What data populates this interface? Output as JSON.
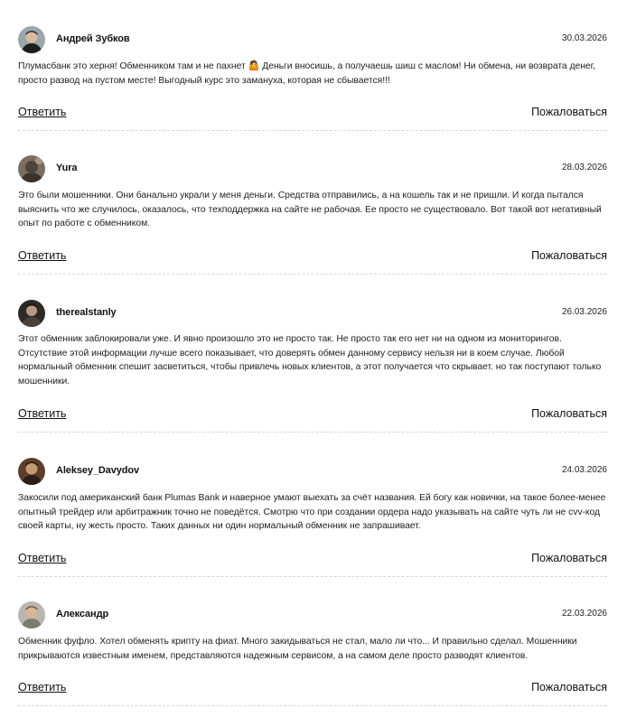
{
  "actions": {
    "reply_label": "Ответить",
    "complain_label": "Пожаловаться"
  },
  "comments": [
    {
      "author": "Андрей Зубков",
      "date": "30.03.2026",
      "avatar_icon": "user-photo-icon",
      "avatar_color": "#6b7a80",
      "text": "Плумасбанк это херня! Обменником там и не пахнет 🤷 Деньги вносишь, а получаешь шиш с маслом! Ни обмена, ни возврата денег, просто развод на пустом месте! Выгодный курс это замануха, которая не сбывается!!!"
    },
    {
      "author": "Yura",
      "date": "28.03.2026",
      "avatar_icon": "user-photo-icon",
      "avatar_color": "#5a5048",
      "text": "Это были мошенники. Они банально украли у меня деньги. Средства отправились, а на кошель так и не пришли. И когда пытался выяснить что же случилось, оказалось, что техподдержка на сайте не рабочая. Ее просто не существовало. Вот такой вот негативный опыт по работе с обменником."
    },
    {
      "author": "therealstanly",
      "date": "26.03.2026",
      "avatar_icon": "user-photo-icon",
      "avatar_color": "#3a3430",
      "text": "Этот обменник заблокировали уже. И явно произошло это не просто так. Не просто так его нет ни на одном из мониторингов. Отсутствие этой информации лучше всего показывает, что доверять обмен данному сервису нельзя ни в коем случае. Любой нормальный обменник спешит засветиться, чтобы привлечь новых клиентов, а этот получается что скрывает. но так поступают только мошенники."
    },
    {
      "author": "Aleksey_Davydov",
      "date": "24.03.2026",
      "avatar_icon": "user-photo-icon",
      "avatar_color": "#6e4a30",
      "text": "Закосили под американский банк Plumas Bank и наверное умают выехать за счёт названия. Ей богу как новички, на такое более-менее опытный трейдер или арбитражник точно не поведётся. Смотрю что при создании ордера надо указывать на сайте чуть ли не cvv-код своей карты, ну жесть просто. Таких данных ни один нормальный обменник не запрашивает."
    },
    {
      "author": "Александр",
      "date": "22.03.2026",
      "avatar_icon": "user-photo-icon",
      "avatar_color": "#8a8a80",
      "text": "Обменник фуфло. Хотел обменять крипту на фиат. Много закидываться не стал, мало ли что... И правильно сделал. Мошенники прикрываются известным именем, представляются надежным сервисом, а на самом деле просто разводят клиентов."
    }
  ]
}
